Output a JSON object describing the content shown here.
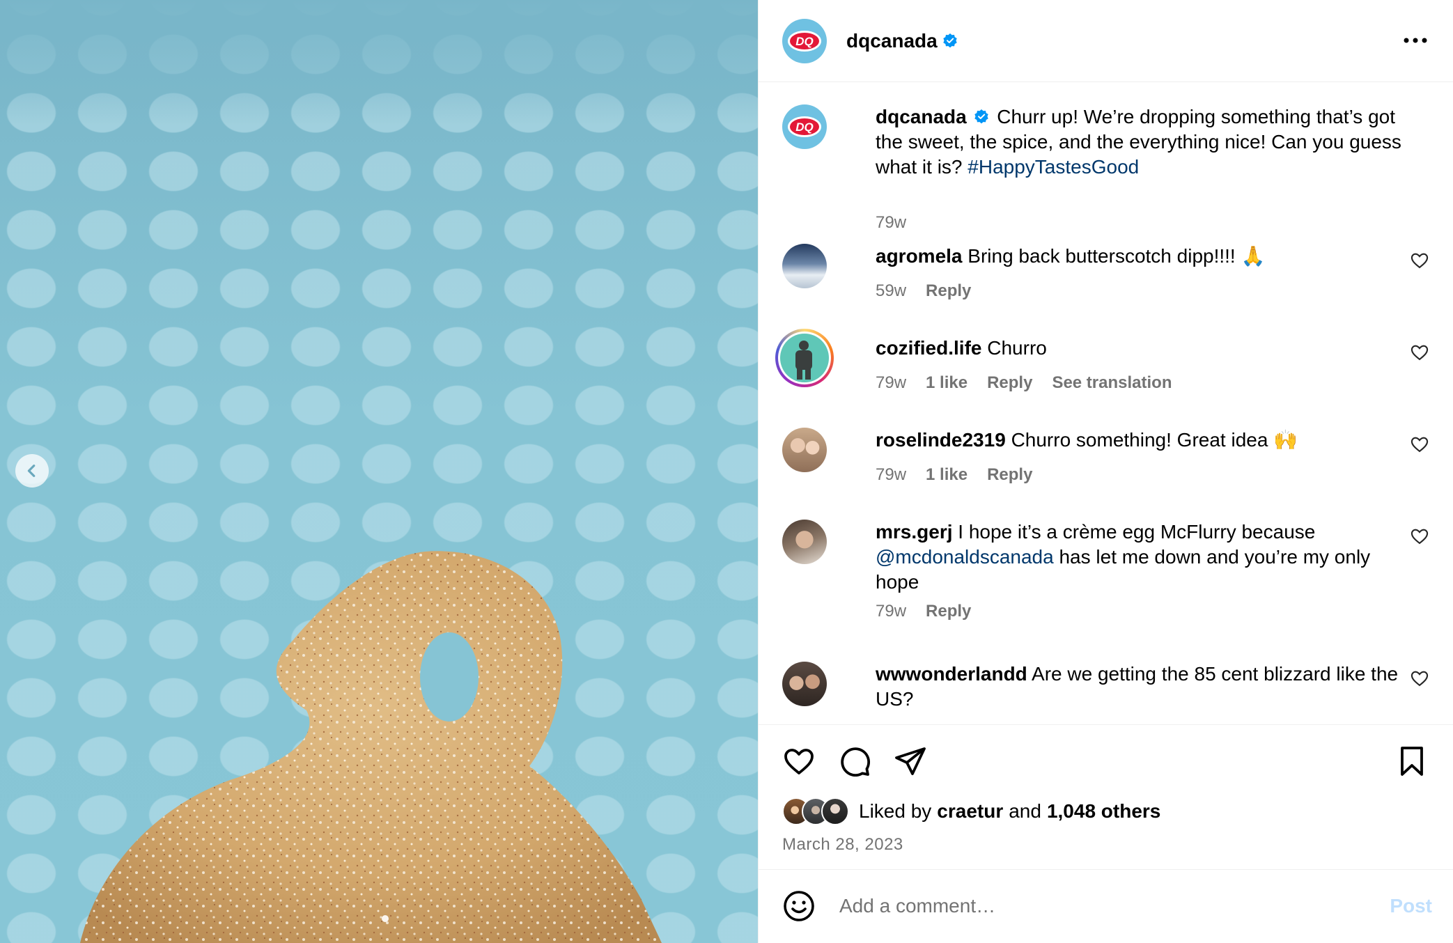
{
  "post": {
    "author": "dqcanada",
    "caption": "Churr up! We’re dropping something that’s got the sweet, the spice, and the everything nice! Can you guess what it is?",
    "hashtag": "#HappyTastesGood",
    "age": "79w",
    "likes_prefix": "Liked by",
    "liked_by": "craetur",
    "likes_and": "and",
    "likes_others": "1,048 others",
    "date": "March 28, 2023"
  },
  "comments": [
    {
      "user": "agromela",
      "text": "Bring back butterscotch dipp!!!! 🙏",
      "age": "59w",
      "likes": "",
      "reply": "Reply",
      "translate": ""
    },
    {
      "user": "cozified.life",
      "text": "Churro",
      "age": "79w",
      "likes": "1 like",
      "reply": "Reply",
      "translate": "See translation"
    },
    {
      "user": "roselinde2319",
      "text": "Churro something! Great idea 🙌",
      "age": "79w",
      "likes": "1 like",
      "reply": "Reply",
      "translate": ""
    },
    {
      "user": "mrs.gerj",
      "text_before": "I hope it’s a crème egg McFlurry because",
      "mention": "@mcdonaldscanada",
      "text_after": "has let me down and you’re my only hope",
      "age": "79w",
      "likes": "",
      "reply": "Reply",
      "translate": ""
    },
    {
      "user": "wwwonderlandd",
      "text": "Are we getting the 85 cent blizzard like the US?",
      "age": "",
      "likes": "",
      "reply": "",
      "translate": ""
    }
  ],
  "add_comment": {
    "placeholder": "Add a comment…",
    "post_label": "Post"
  },
  "brand": {
    "logo_text": "DQ",
    "dq_red": "#e31837",
    "accent": "#0095f6",
    "link": "#00376b"
  }
}
